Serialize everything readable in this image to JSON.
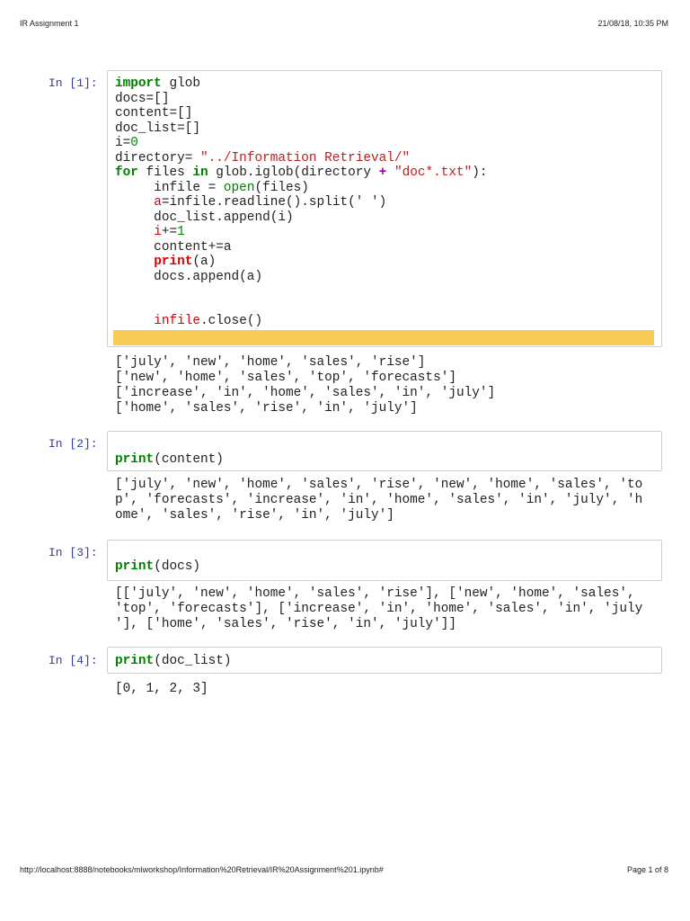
{
  "header": {
    "title": "IR Assignment 1",
    "datetime": "21/08/18, 10:35 PM"
  },
  "footer": {
    "url": "http://localhost:8888/notebooks/mlworkshop/Information%20Retrieval/IR%20Assignment%201.ipynb#",
    "page": "Page 1 of 8"
  },
  "colors": {
    "prompt": "#303f9f",
    "keyword": "#008000",
    "string": "#ba2121",
    "highlight": "#f7cb55"
  },
  "cells": [
    {
      "prompt": "In [1]:",
      "code": [
        [
          [
            "import",
            "kw"
          ],
          [
            " glob",
            ""
          ]
        ],
        [
          [
            "docs=[]",
            ""
          ]
        ],
        [
          [
            "content=[]",
            ""
          ]
        ],
        [
          [
            "doc_list=[]",
            ""
          ]
        ],
        [
          [
            "i=",
            ""
          ],
          [
            "0",
            "num"
          ]
        ],
        [
          [
            "directory= ",
            ""
          ],
          [
            "\"../Information Retrieval/\"",
            "str"
          ]
        ],
        [
          [
            "for",
            "kw"
          ],
          [
            " files ",
            ""
          ],
          [
            "in",
            "kw"
          ],
          [
            " glob.iglob(directory ",
            ""
          ],
          [
            "+",
            "op"
          ],
          [
            " ",
            ""
          ],
          [
            "\"doc*.txt\"",
            "str"
          ],
          [
            "):",
            ""
          ]
        ],
        [
          [
            "     infile = ",
            ""
          ],
          [
            "open",
            "bi"
          ],
          [
            "(files)",
            ""
          ]
        ],
        [
          [
            "     ",
            ""
          ],
          [
            "a",
            "var"
          ],
          [
            "=infile.readline().split(' ')",
            ""
          ]
        ],
        [
          [
            "     doc_list.append(i)",
            ""
          ]
        ],
        [
          [
            "     ",
            ""
          ],
          [
            "i",
            "var"
          ],
          [
            "+=",
            ""
          ],
          [
            "1",
            "num"
          ]
        ],
        [
          [
            "     content+=a",
            ""
          ]
        ],
        [
          [
            "     ",
            ""
          ],
          [
            "print",
            "kwr"
          ],
          [
            "(a)",
            ""
          ]
        ],
        [
          [
            "     docs.append(a)",
            ""
          ]
        ],
        [
          [
            "",
            ""
          ]
        ],
        [
          [
            "",
            ""
          ]
        ],
        [
          [
            "     ",
            ""
          ],
          [
            "infile",
            "var"
          ],
          [
            ".close()",
            ""
          ]
        ]
      ],
      "output": [
        "['july', 'new', 'home', 'sales', 'rise']",
        "['new', 'home', 'sales', 'top', 'forecasts']",
        "['increase', 'in', 'home', 'sales', 'in', 'july']",
        "['home', 'sales', 'rise', 'in', 'july']"
      ]
    },
    {
      "prompt": "In [2]:",
      "code": [
        [
          [
            "",
            ""
          ]
        ],
        [
          [
            "print",
            "kw"
          ],
          [
            "(content)",
            ""
          ]
        ]
      ],
      "output": [
        "['july', 'new', 'home', 'sales', 'rise', 'new', 'home', 'sales', 'to",
        "p', 'forecasts', 'increase', 'in', 'home', 'sales', 'in', 'july', 'h",
        "ome', 'sales', 'rise', 'in', 'july']"
      ]
    },
    {
      "prompt": "In [3]:",
      "code": [
        [
          [
            "",
            ""
          ]
        ],
        [
          [
            "print",
            "kw"
          ],
          [
            "(docs)",
            ""
          ]
        ]
      ],
      "output": [
        "[['july', 'new', 'home', 'sales', 'rise'], ['new', 'home', 'sales',",
        "'top', 'forecasts'], ['increase', 'in', 'home', 'sales', 'in', 'july",
        "'], ['home', 'sales', 'rise', 'in', 'july']]"
      ]
    },
    {
      "prompt": "In [4]:",
      "code": [
        [
          [
            "print",
            "kw"
          ],
          [
            "(doc_list)",
            ""
          ]
        ]
      ],
      "output": [
        "[0, 1, 2, 3]"
      ]
    }
  ]
}
